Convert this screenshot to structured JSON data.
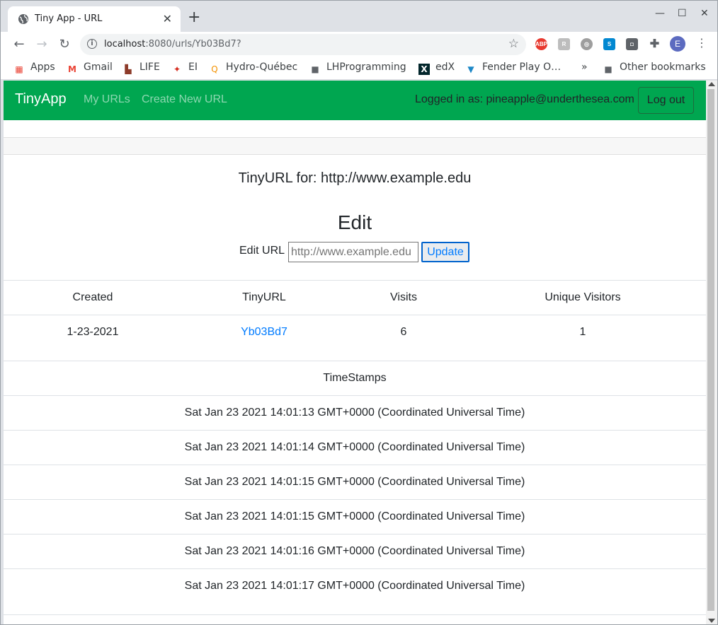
{
  "browser": {
    "tab_title": "Tiny App - URL",
    "url_host": "localhost",
    "url_path": ":8080/urls/Yb03Bd7?",
    "bookmarks": [
      "Apps",
      "Gmail",
      "LIFE",
      "EI",
      "Hydro-Québec",
      "LHProgramming",
      "edX",
      "Fender Play O…",
      "Other bookmarks"
    ],
    "profile_initial": "E",
    "ext_abp": "ABP"
  },
  "nav": {
    "brand": "TinyApp",
    "my_urls": "My URLs",
    "create_new": "Create New URL",
    "logged_in": "Logged in as: pineapple@underthesea.com",
    "logout": "Log out"
  },
  "main": {
    "tiny_title": "TinyURL for: http://www.example.edu",
    "edit_heading": "Edit",
    "edit_label": "Edit URL",
    "edit_placeholder": "http://www.example.edu",
    "update_button": "Update"
  },
  "stats": {
    "headers": [
      "Created",
      "TinyURL",
      "Visits",
      "Unique Visitors"
    ],
    "row": [
      "1-23-2021",
      "Yb03Bd7",
      "6",
      "1"
    ]
  },
  "timestamps": {
    "header": "TimeStamps",
    "items": [
      "Sat Jan 23 2021 14:01:13 GMT+0000 (Coordinated Universal Time)",
      "Sat Jan 23 2021 14:01:14 GMT+0000 (Coordinated Universal Time)",
      "Sat Jan 23 2021 14:01:15 GMT+0000 (Coordinated Universal Time)",
      "Sat Jan 23 2021 14:01:15 GMT+0000 (Coordinated Universal Time)",
      "Sat Jan 23 2021 14:01:16 GMT+0000 (Coordinated Universal Time)",
      "Sat Jan 23 2021 14:01:17 GMT+0000 (Coordinated Universal Time)"
    ]
  },
  "colors": {
    "navbar": "#00a650",
    "link": "#007bff"
  }
}
